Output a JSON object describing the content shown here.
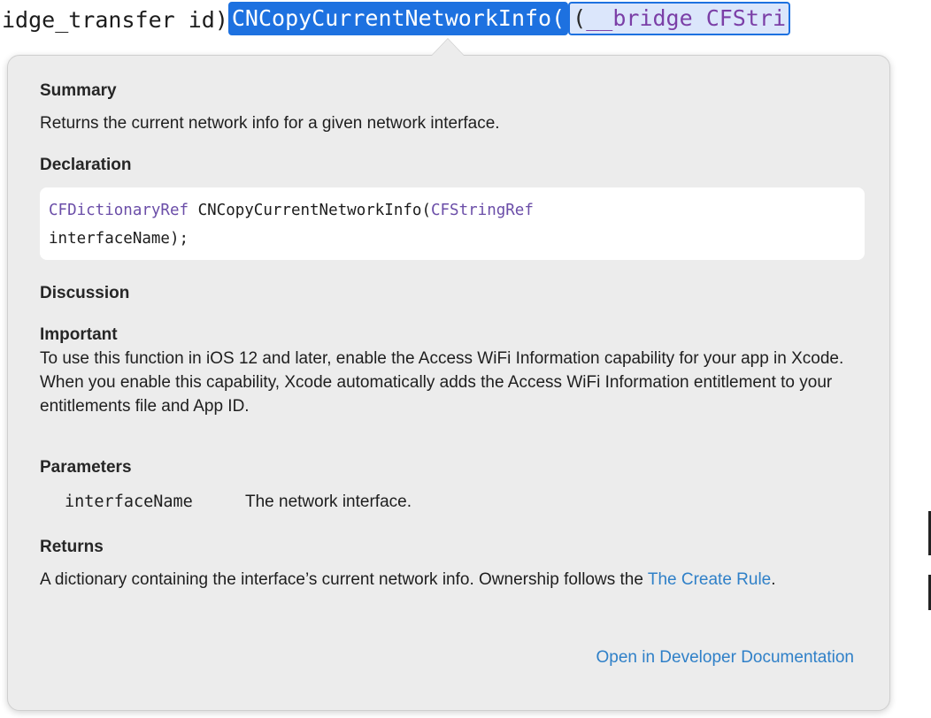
{
  "code_line": {
    "prefix": "idge_transfer id)",
    "selected_symbol": "CNCopyCurrentNetworkInfo(",
    "arg_open": "(",
    "arg_keyword": "__bridge CFStri"
  },
  "popover": {
    "summary_heading": "Summary",
    "summary_text": "Returns the current network info for a given network interface.",
    "declaration_heading": "Declaration",
    "declaration": {
      "return_type": "CFDictionaryRef",
      "function_name": " CNCopyCurrentNetworkInfo(",
      "param_type": "CFStringRef",
      "param_rest": "interfaceName);"
    },
    "discussion_heading": "Discussion",
    "important_heading": "Important",
    "important_text": "To use this function in iOS 12 and later, enable the Access WiFi Information capability for your app in Xcode. When you enable this capability, Xcode automatically adds the Access WiFi Information entitlement to your entitlements file and App ID.",
    "parameters_heading": "Parameters",
    "parameters": [
      {
        "name": "interfaceName",
        "description": "The network interface."
      }
    ],
    "returns_heading": "Returns",
    "returns_text": "A dictionary containing the interface’s current network info. Ownership follows the ",
    "returns_link": "The Create Rule",
    "returns_end": ".",
    "open_docs_link": "Open in Developer Documentation"
  },
  "colors": {
    "selection": "#1d71e0",
    "link": "#2f80c8",
    "popover_bg": "#ececec",
    "type_purple": "#6b4ea8"
  }
}
